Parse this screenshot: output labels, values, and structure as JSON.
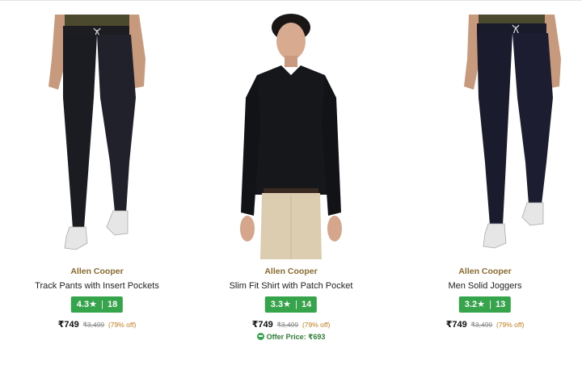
{
  "products": [
    {
      "brand": "Allen Cooper",
      "title": "Track Pants with Insert Pockets",
      "rating": "4.3",
      "star": "★",
      "separator": "|",
      "reviews": "18",
      "price": "₹749",
      "mrp": "₹3,499",
      "discount": "(79% off)",
      "image_icon": "product-image-track-pants"
    },
    {
      "brand": "Allen Cooper",
      "title": "Slim Fit Shirt with Patch Pocket",
      "rating": "3.3",
      "star": "★",
      "separator": "|",
      "reviews": "14",
      "price": "₹749",
      "mrp": "₹3,499",
      "discount": "(79% off)",
      "offer_text": "Offer Price: ₹693",
      "image_icon": "product-image-shirt"
    },
    {
      "brand": "Allen Cooper",
      "title": "Men Solid Joggers",
      "rating": "3.2",
      "star": "★",
      "separator": "|",
      "reviews": "13",
      "price": "₹749",
      "mrp": "₹3,499",
      "discount": "(79% off)",
      "image_icon": "product-image-joggers"
    }
  ],
  "colors": {
    "brand": "#8b6a2f",
    "rating_badge": "#35a44a",
    "discount": "#c77a19",
    "offer": "#2f7d36"
  }
}
